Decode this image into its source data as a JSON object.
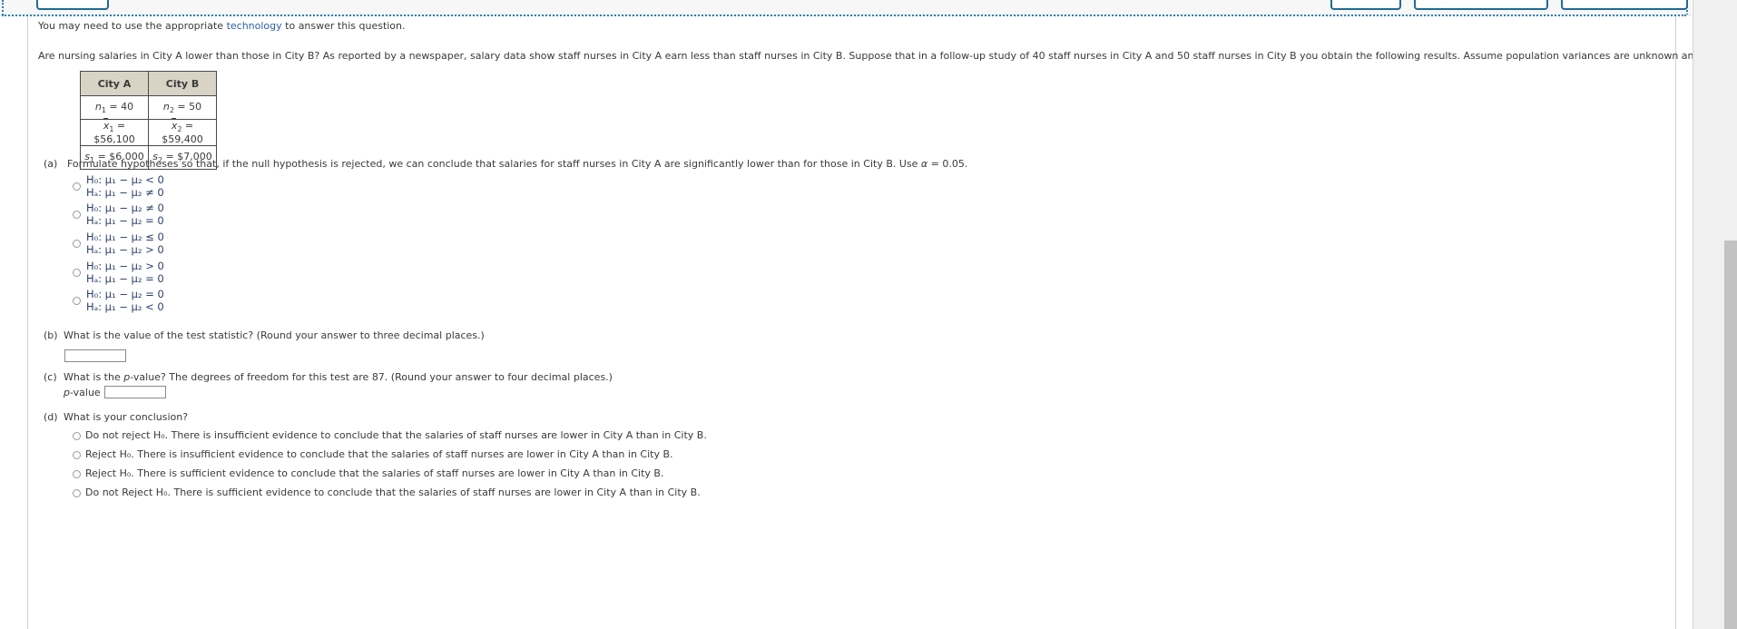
{
  "toolbar": {
    "buttons": [
      {
        "name": "toolbar-button-1",
        "label": ""
      },
      {
        "name": "toolbar-button-2",
        "label": ""
      },
      {
        "name": "toolbar-button-3",
        "label": ""
      },
      {
        "name": "toolbar-button-4",
        "label": ""
      }
    ]
  },
  "tech_note": {
    "before": "You may need to use the appropriate ",
    "link": "technology",
    "after": " to answer this question."
  },
  "prompt": "Are nursing salaries in City A lower than those in City B? As reported by a newspaper, salary data show staff nurses in City A earn less than staff nurses in City B. Suppose that in a follow-up study of 40 staff nurses in City A and 50 staff nurses in City B you obtain the following results. Assume population variances are unknown and unequal.",
  "stats_table": {
    "headers": [
      "City A",
      "City B"
    ],
    "rows": [
      [
        {
          "var": "n",
          "sub": "1",
          "value": "40",
          "italic": true,
          "bar": false
        },
        {
          "var": "n",
          "sub": "2",
          "value": "50",
          "italic": true,
          "bar": false
        }
      ],
      [
        {
          "var": "x",
          "sub": "1",
          "value": "$56,100",
          "italic": true,
          "bar": true
        },
        {
          "var": "x",
          "sub": "2",
          "value": "$59,400",
          "italic": true,
          "bar": true
        }
      ],
      [
        {
          "var": "s",
          "sub": "1",
          "value": "$6,000",
          "italic": true,
          "bar": false
        },
        {
          "var": "s",
          "sub": "2",
          "value": "$7,000",
          "italic": true,
          "bar": false
        }
      ]
    ]
  },
  "part_a": {
    "marker": "(a)",
    "text_1": "Formulate hypotheses so that, if the null hypothesis is rejected, we can conclude that salaries for staff nurses in City A are significantly lower than for those in City B. Use ",
    "alpha": "α",
    "text_2": " = 0.05.",
    "options": [
      {
        "null": "H₀: μ₁ − μ₂ < 0",
        "alt": "Hₐ: μ₁ − μ₂ ≠ 0"
      },
      {
        "null": "H₀: μ₁ − μ₂ ≠ 0",
        "alt": "Hₐ: μ₁ − μ₂ = 0"
      },
      {
        "null": "H₀: μ₁ − μ₂ ≤ 0",
        "alt": "Hₐ: μ₁ − μ₂ > 0"
      },
      {
        "null": "H₀: μ₁ − μ₂ > 0",
        "alt": "Hₐ: μ₁ − μ₂ = 0"
      },
      {
        "null": "H₀: μ₁ − μ₂ = 0",
        "alt": "Hₐ: μ₁ − μ₂ < 0"
      }
    ]
  },
  "part_b": {
    "marker": "(b)",
    "text": "What is the value of the test statistic? (Round your answer to three decimal places.)",
    "input_value": "",
    "input_placeholder": ""
  },
  "part_c": {
    "marker": "(c)",
    "text_before": "What is the ",
    "text_italic": "p",
    "text_after": "-value? The degrees of freedom for this test are 87. (Round your answer to four decimal places.)",
    "answer_label_italic": "p",
    "answer_label_rest": "-value = ",
    "input_value": "",
    "input_placeholder": ""
  },
  "part_d": {
    "marker": "(d)",
    "text": "What is your conclusion?",
    "options": [
      "Do not reject H₀. There is insufficient evidence to conclude that the salaries of staff nurses are lower in City A than in City B.",
      "Reject H₀. There is insufficient evidence to conclude that the salaries of staff nurses are lower in City A than in City B.",
      "Reject H₀. There is sufficient evidence to conclude that the salaries of staff nurses are lower in City A than in City B.",
      "Do not Reject H₀. There is sufficient evidence to conclude that the salaries of staff nurses are lower in City A than in City B."
    ]
  },
  "colors": {
    "link": "#2b5fa8",
    "table_header_bg": "#d8d3c4",
    "hypothesis_text": "#2e3f6e",
    "button_border": "#1f6a94"
  }
}
